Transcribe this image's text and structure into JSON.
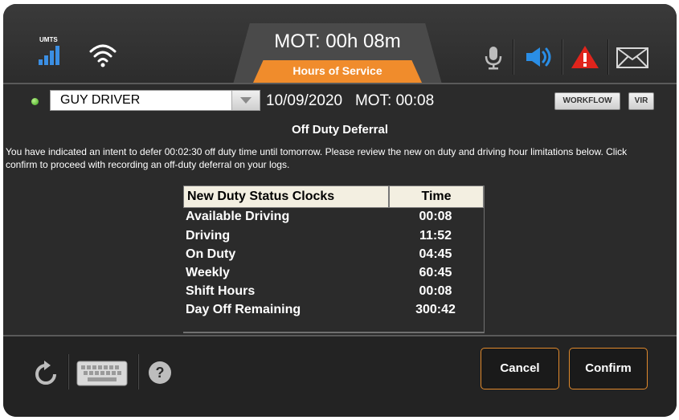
{
  "topbar": {
    "network_label": "UMTS",
    "mot_title": "MOT: 00h 08m",
    "tab_label": "Hours of Service",
    "icons": [
      "signal-icon",
      "wifi-icon",
      "microphone-icon",
      "speaker-icon",
      "warning-icon",
      "mail-icon"
    ],
    "colors": {
      "accent": "#f08c2c",
      "speaker": "#2a8ee6",
      "warning": "#e0241c",
      "signal": "#3b8fe4"
    }
  },
  "driver_bar": {
    "status_color": "#3ea81c",
    "driver_name": "GUY DRIVER",
    "date": "10/09/2020",
    "mot": "MOT: 00:08",
    "workflow_label": "WORKFLOW",
    "vir_label": "VIR"
  },
  "main": {
    "heading": "Off Duty Deferral",
    "description": "You have indicated an intent to defer 00:02:30 off duty time until tomorrow. Please review the new on duty and driving hour limitations below. Click confirm to proceed with recording an off-duty deferral on your logs."
  },
  "table": {
    "headers": [
      "New Duty Status Clocks",
      "Time"
    ],
    "rows": [
      {
        "label": "Available Driving",
        "value": "00:08"
      },
      {
        "label": "Driving",
        "value": "11:52"
      },
      {
        "label": "On Duty",
        "value": "04:45"
      },
      {
        "label": "Weekly",
        "value": "60:45"
      },
      {
        "label": "Shift Hours",
        "value": "00:08"
      },
      {
        "label": "Day Off Remaining",
        "value": "300:42"
      }
    ]
  },
  "footer": {
    "icons": [
      "refresh-icon",
      "keyboard-icon",
      "help-icon"
    ],
    "cancel_label": "Cancel",
    "confirm_label": "Confirm"
  }
}
